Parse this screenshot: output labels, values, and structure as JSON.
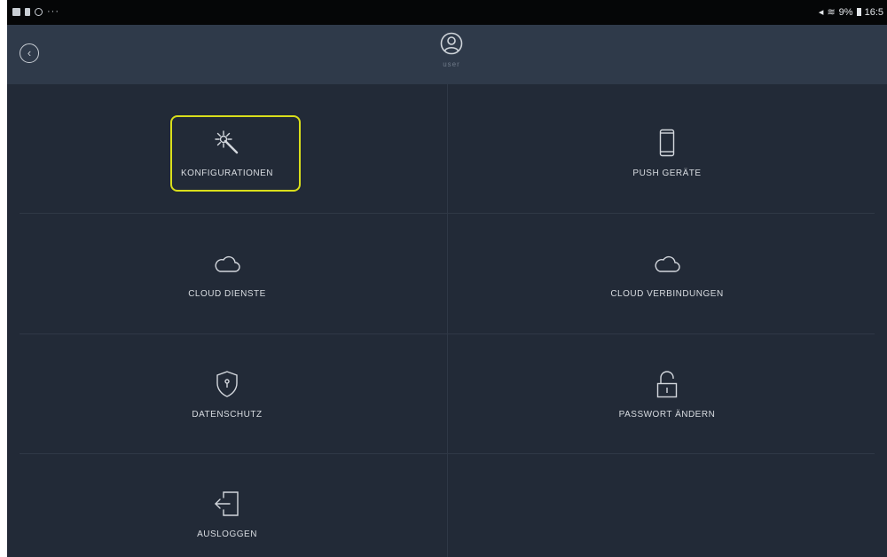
{
  "status_bar": {
    "left_icons": [
      "gallery-icon",
      "battery-saver-icon",
      "sync-icon"
    ],
    "left_more": "···",
    "right_text": "9%",
    "time": "16:5"
  },
  "header": {
    "user_name": "user"
  },
  "menu": {
    "items": [
      {
        "label": "KONFIGURATIONEN",
        "icon": "magic-wand-icon"
      },
      {
        "label": "PUSH GERÄTE",
        "icon": "phone-icon"
      },
      {
        "label": "CLOUD DIENSTE",
        "icon": "cloud-icon"
      },
      {
        "label": "CLOUD VERBINDUNGEN",
        "icon": "cloud-icon"
      },
      {
        "label": "DATENSCHUTZ",
        "icon": "shield-icon"
      },
      {
        "label": "PASSWORT ÄNDERN",
        "icon": "unlock-icon"
      },
      {
        "label": "AUSLOGGEN",
        "icon": "logout-icon"
      }
    ]
  },
  "colors": {
    "background": "#222a37",
    "header": "#2f3a4a",
    "highlight": "#d9de1b",
    "text": "#d8dce1"
  }
}
